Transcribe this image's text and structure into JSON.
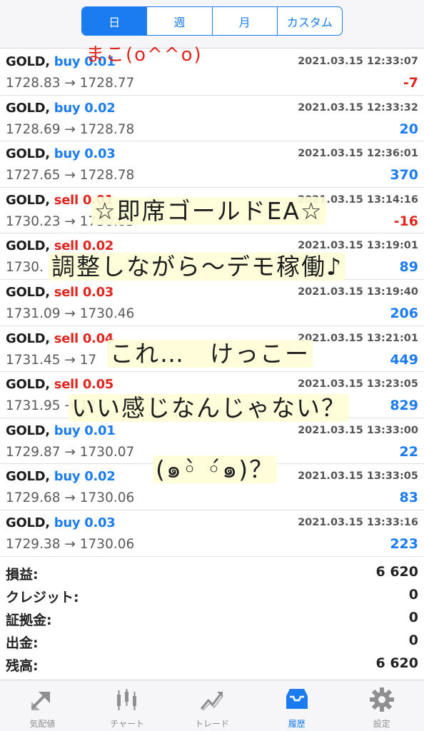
{
  "period_tabs": [
    {
      "label": "日",
      "active": true
    },
    {
      "label": "週",
      "active": false
    },
    {
      "label": "月",
      "active": false
    },
    {
      "label": "カスタム",
      "active": false
    }
  ],
  "trades": [
    {
      "symbol": "GOLD,",
      "side": "buy 0.01",
      "type": "buy",
      "time": "2021.03.15 12:33:07",
      "prices": "1728.83 → 1728.77",
      "profit": "-7"
    },
    {
      "symbol": "GOLD,",
      "side": "buy 0.02",
      "type": "buy",
      "time": "2021.03.15 12:33:32",
      "prices": "1728.69 → 1728.78",
      "profit": "20"
    },
    {
      "symbol": "GOLD,",
      "side": "buy 0.03",
      "type": "buy",
      "time": "2021.03.15 12:36:01",
      "prices": "1727.65 → 1728.78",
      "profit": "370"
    },
    {
      "symbol": "GOLD,",
      "side": "sell 0.01",
      "type": "sell",
      "time": "2021.03.15 13:14:16",
      "prices": "1730.23 → 1730.03",
      "profit": "-16"
    },
    {
      "symbol": "GOLD,",
      "side": "sell 0.02",
      "type": "sell",
      "time": "2021.03.15 13:19:01",
      "prices": "1730.",
      "profit": "89"
    },
    {
      "symbol": "GOLD,",
      "side": "sell 0.03",
      "type": "sell",
      "time": "2021.03.15 13:19:40",
      "prices": "1731.09 → 1730.46",
      "profit": "206"
    },
    {
      "symbol": "GOLD,",
      "side": "sell 0.04",
      "type": "sell",
      "time": "2021.03.15 13:21:01",
      "prices": "1731.45 → 17",
      "profit": "449"
    },
    {
      "symbol": "GOLD,",
      "side": "sell 0.05",
      "type": "sell",
      "time": "2021.03.15 13:23:05",
      "prices": "1731.95 → 17",
      "profit": "829"
    },
    {
      "symbol": "GOLD,",
      "side": "buy 0.01",
      "type": "buy",
      "time": "2021.03.15 13:33:00",
      "prices": "1729.87 → 1730.07",
      "profit": "22"
    },
    {
      "symbol": "GOLD,",
      "side": "buy 0.02",
      "type": "buy",
      "time": "2021.03.15 13:33:05",
      "prices": "1729.68 → 1730.06",
      "profit": "83"
    },
    {
      "symbol": "GOLD,",
      "side": "buy 0.03",
      "type": "buy",
      "time": "2021.03.15 13:33:16",
      "prices": "1729.38 → 1730.06",
      "profit": "223"
    }
  ],
  "summary": [
    {
      "label": "損益:",
      "value": "6 620"
    },
    {
      "label": "クレジット:",
      "value": "0"
    },
    {
      "label": "証拠金:",
      "value": "0"
    },
    {
      "label": "出金:",
      "value": "0"
    },
    {
      "label": "残高:",
      "value": "6 620"
    }
  ],
  "tabbar": [
    {
      "label": "気配値",
      "icon": "quotes-icon",
      "active": false
    },
    {
      "label": "チャート",
      "icon": "chart-icon",
      "active": false
    },
    {
      "label": "トレード",
      "icon": "trade-icon",
      "active": false
    },
    {
      "label": "履歴",
      "icon": "history-icon",
      "active": true
    },
    {
      "label": "設定",
      "icon": "settings-icon",
      "active": false
    }
  ],
  "annotations": {
    "red_note": "まこ(o^^o)",
    "line1": "☆即席ゴールドEA☆",
    "line2": "調整しながら〜デモ稼働♪",
    "line3": "これ…　けっこー",
    "line4": "いい感じなんじゃない？",
    "line5": "(๑◦̀ ◦́๑)？"
  },
  "colors": {
    "accent": "#1a7cf0",
    "sell": "#e0271f",
    "loss": "#e0271f"
  }
}
